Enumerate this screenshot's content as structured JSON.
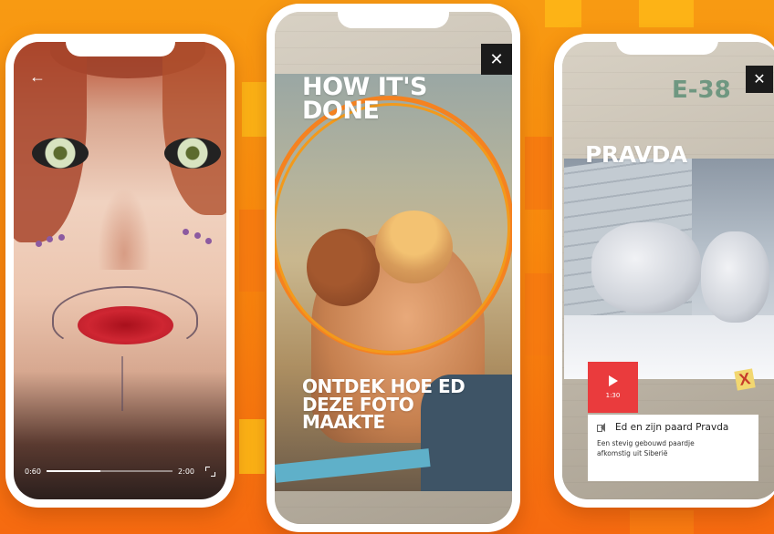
{
  "colors": {
    "accent_orange": "#f7941d",
    "background_orange": "#fb8b0e",
    "play_red": "#ea3b3d",
    "close_dark": "#1b1b1b"
  },
  "phones": [
    {
      "id": "video-player",
      "back_icon": "arrow-left-icon",
      "player": {
        "current_time": "0:60",
        "total_time": "2:00",
        "progress": 0.43,
        "fullscreen_icon": "fullscreen-icon"
      }
    },
    {
      "id": "how-its-done",
      "title": "HOW IT'S DONE",
      "subtitle": "ONTDEK HOE ED DEZE FOTO MAAKTE",
      "close_icon": "close-icon"
    },
    {
      "id": "pravda",
      "title": "PRAVDA",
      "close_icon": "close-icon",
      "scribble": "E-38",
      "audio": {
        "duration": "1:30",
        "play_icon": "play-icon",
        "speaker_icon": "speaker-icon",
        "title": "Ed en zijn paard Pravda",
        "description": "Een stevig gebouwd paardje afkomstig uit Siberië"
      },
      "mark": "X"
    }
  ]
}
